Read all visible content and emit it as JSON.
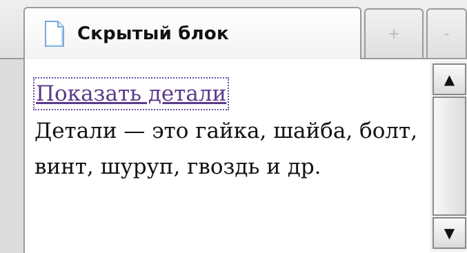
{
  "tab": {
    "title": "Скрытый блок",
    "icon": "document-icon",
    "add_label": "+",
    "minimize_label": "-"
  },
  "content": {
    "link_text": "Показать детали",
    "detail_text": "Детали — это гайка, шайба, болт, винт, шуруп, гвоздь и др."
  },
  "scrollbar": {
    "up_icon": "arrow-up-icon",
    "down_icon": "arrow-down-icon",
    "up_glyph": "▲",
    "down_glyph": "▼"
  },
  "colors": {
    "link": "#5b3a8a",
    "border": "#9a9a9a",
    "panel_bg": "#ffffff"
  }
}
